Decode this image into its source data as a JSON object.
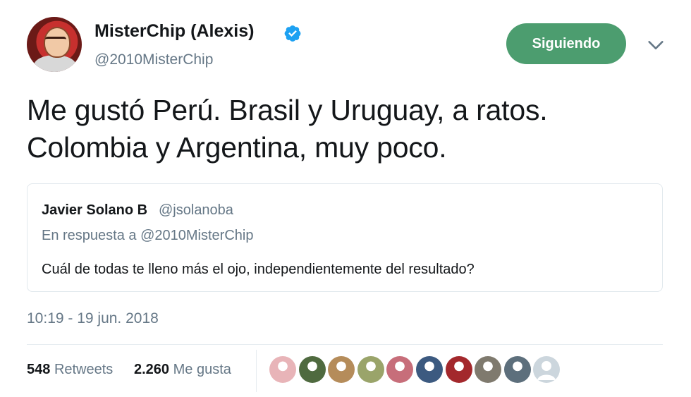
{
  "author": {
    "display_name": "MisterChip (Alexis)",
    "handle": "@2010MisterChip",
    "verified": true,
    "verified_color": "#1da1f2"
  },
  "follow_button": {
    "label": "Siguiendo",
    "color": "#4c9d6f"
  },
  "tweet": {
    "lines": [
      "Me gustó Perú. Brasil y Uruguay, a ratos.",
      "Colombia y Argentina, muy poco."
    ]
  },
  "quoted_tweet": {
    "display_name": "Javier Solano B",
    "handle": "@jsolanoba",
    "reply_to": "En respuesta a @2010MisterChip",
    "text": "Cuál de todas te lleno más el ojo, independientemente del resultado?"
  },
  "timestamp": "10:19 - 19 jun. 2018",
  "stats": {
    "retweets_count": "548",
    "retweets_label": "Retweets",
    "likes_count": "2.260",
    "likes_label": "Me gusta"
  },
  "likers": [
    {
      "icon": "user-avatar-1",
      "color": "#e8b4b8"
    },
    {
      "icon": "user-avatar-2",
      "color": "#4f6a3f"
    },
    {
      "icon": "user-avatar-3",
      "color": "#b58c5a"
    },
    {
      "icon": "user-avatar-4",
      "color": "#9aa46a"
    },
    {
      "icon": "user-avatar-5",
      "color": "#c76e7a"
    },
    {
      "icon": "user-avatar-6",
      "color": "#3c5a80"
    },
    {
      "icon": "user-avatar-7",
      "color": "#a3282c"
    },
    {
      "icon": "user-avatar-8",
      "color": "#7f7a6e"
    },
    {
      "icon": "user-avatar-9",
      "color": "#5d6f7c"
    },
    {
      "icon": "default-avatar-icon",
      "color": "#ccd6dd"
    }
  ]
}
